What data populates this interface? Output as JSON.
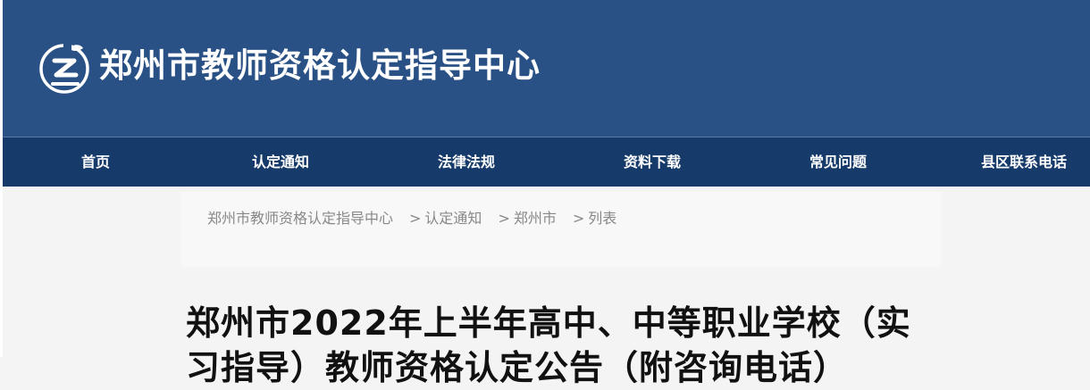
{
  "header": {
    "site_title": "郑州市教师资格认定指导中心",
    "background": "#2a5185"
  },
  "nav": {
    "background": "#163b6b",
    "items": [
      {
        "label": "首页"
      },
      {
        "label": "认定通知"
      },
      {
        "label": "法律法规"
      },
      {
        "label": "资料下载"
      },
      {
        "label": "常见问题"
      },
      {
        "label": "县区联系电话"
      }
    ]
  },
  "breadcrumb": {
    "items": [
      "郑州市教师资格认定指导中心",
      "认定通知",
      "郑州市",
      "列表"
    ],
    "separator": ">"
  },
  "article": {
    "title": "郑州市2022年上半年高中、中等职业学校（实习指导）教师资格认定公告（附咨询电话）"
  }
}
